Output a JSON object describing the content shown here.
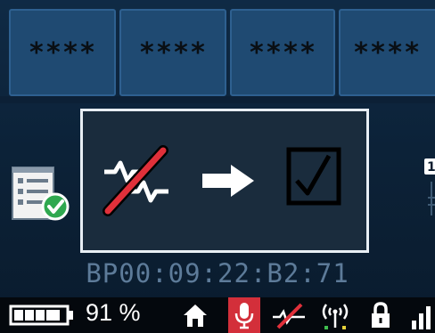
{
  "tiles": [
    {
      "label": "****"
    },
    {
      "label": "****"
    },
    {
      "label": "****"
    },
    {
      "label": "****"
    }
  ],
  "dialog": {
    "from_icon": "no-signal-icon",
    "arrow_icon": "arrow-right-icon",
    "to_icon": "checkbox-checked-icon"
  },
  "device_address": "BP00:09:22:B2:71",
  "status_bar": {
    "battery_percent": "91 %",
    "battery_level": 0.91,
    "icons": [
      "battery-icon",
      "home-icon",
      "microphone-icon",
      "no-signal-icon",
      "antenna-icon",
      "lock-icon",
      "signal-strength-icon"
    ],
    "colors": {
      "mic_background": "#d32f3a",
      "accent_red": "#e0303a",
      "background": "#04080d"
    }
  },
  "side_icons": {
    "left": "checklist-icon",
    "right": "partial-icon"
  }
}
